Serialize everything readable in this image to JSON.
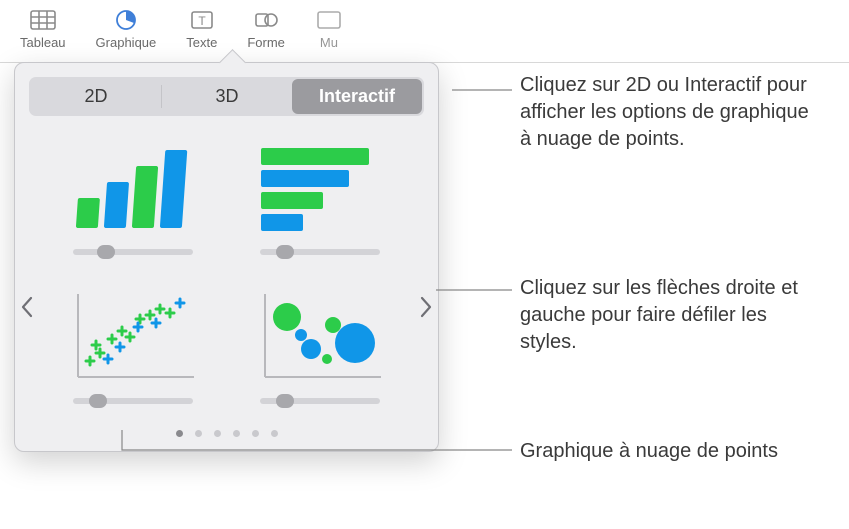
{
  "toolbar": {
    "items": [
      {
        "label": "Tableau"
      },
      {
        "label": "Graphique"
      },
      {
        "label": "Texte"
      },
      {
        "label": "Forme"
      },
      {
        "label": "Mu"
      }
    ]
  },
  "segments": {
    "tab_2d": "2D",
    "tab_3d": "3D",
    "tab_interactive": "Interactif"
  },
  "colors": {
    "green": "#2ccc4a",
    "blue": "#1096e8"
  },
  "callouts": {
    "c1": "Cliquez sur 2D ou Interactif pour afficher les options de graphique à nuage de points.",
    "c2": "Cliquez sur les flèches droite et gauche pour faire défiler les styles.",
    "c3": "Graphique à nuage de points"
  },
  "page_dots": {
    "count": 6,
    "active": 0
  }
}
